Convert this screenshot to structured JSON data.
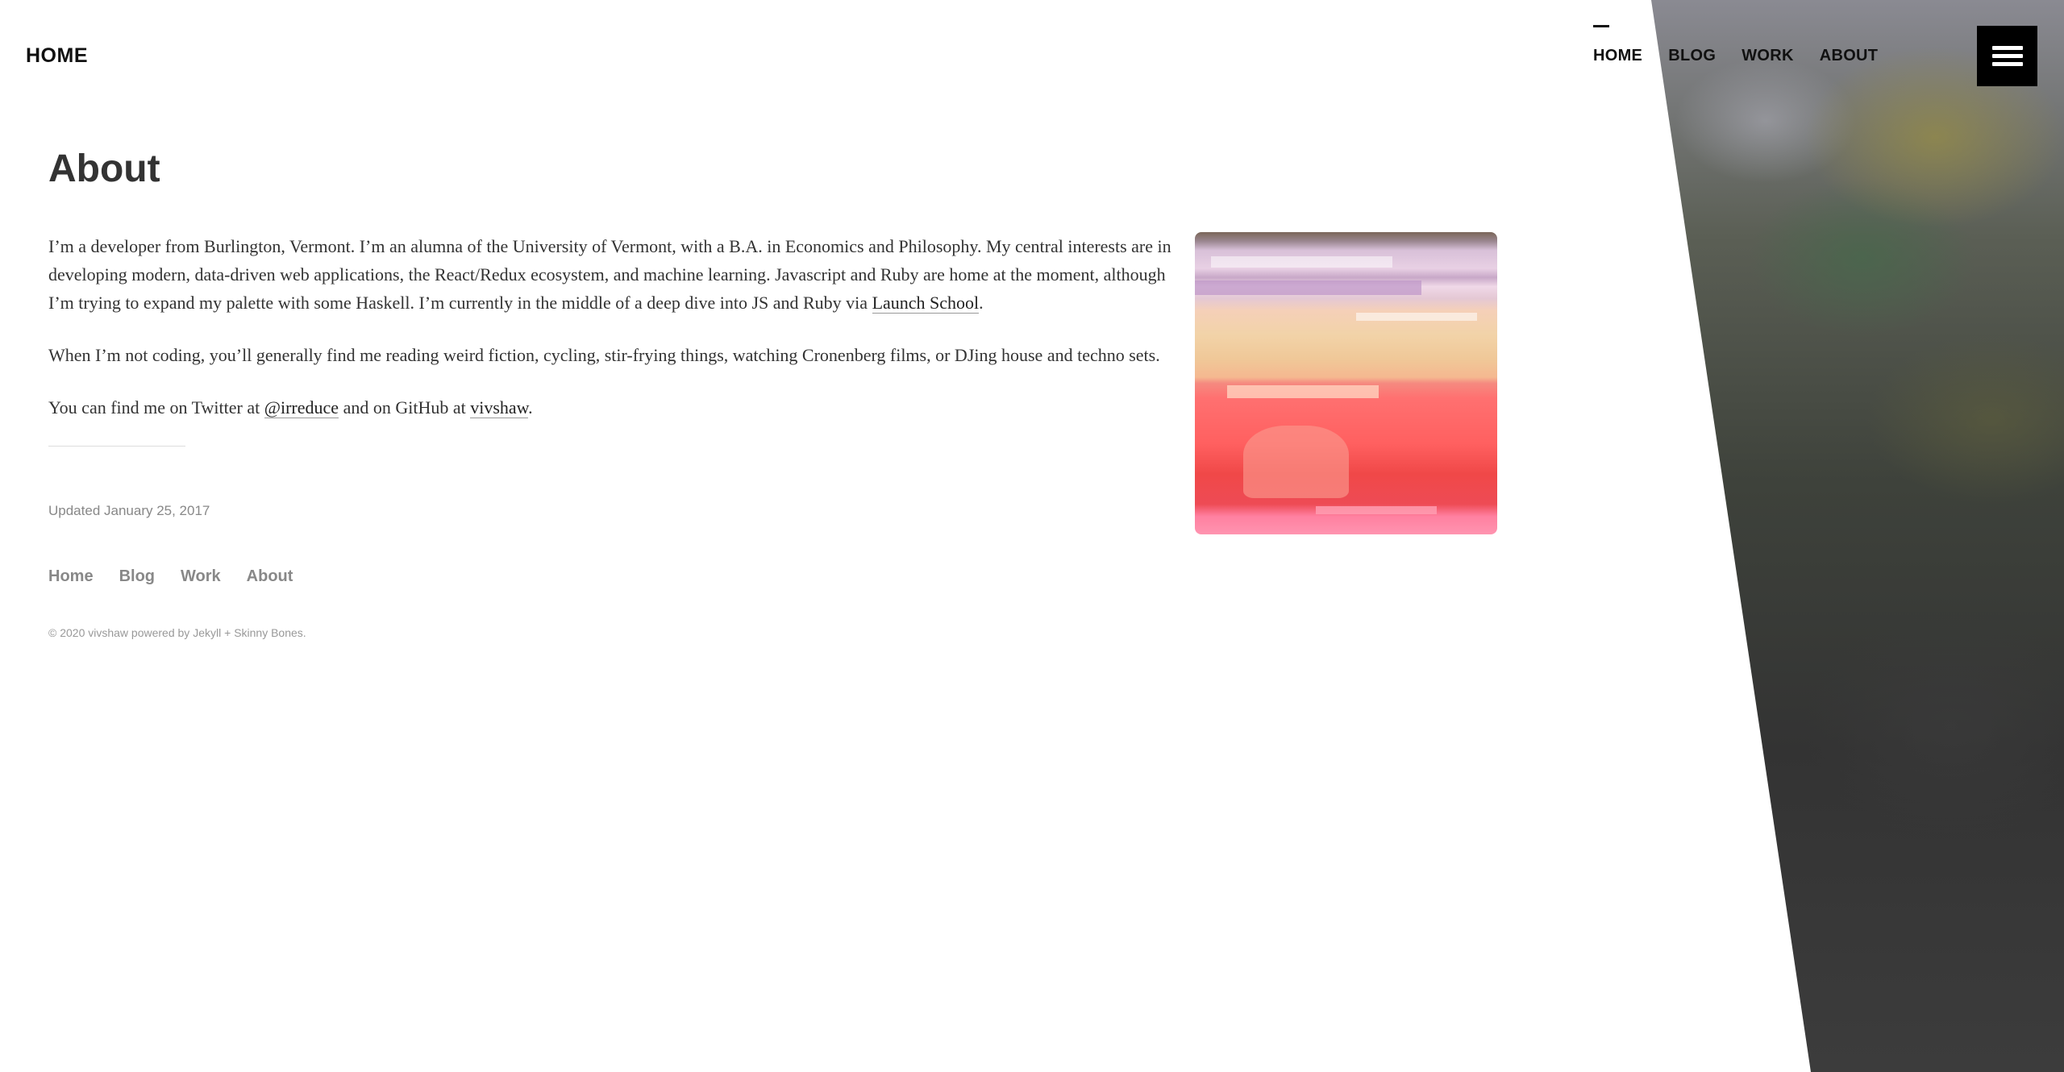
{
  "header": {
    "site_title": "HOME",
    "nav": [
      {
        "label": "HOME",
        "active": true
      },
      {
        "label": "BLOG",
        "active": false
      },
      {
        "label": "WORK",
        "active": false
      },
      {
        "label": "ABOUT",
        "active": false
      }
    ],
    "menu_icon": "hamburger-icon"
  },
  "main": {
    "title": "About",
    "para1_text": "I’m a developer from Burlington, Vermont. I’m an alumna of the University of Vermont, with a B.A. in Economics and Philosophy. My central interests are in developing modern, data-driven web applications, the React/Redux ecosystem, and machine learning. Javascript and Ruby are home at the moment, although I’m trying to expand my palette with some Haskell. I’m currently in the middle of a deep dive into JS and Ruby via ",
    "para1_link": "Launch School",
    "para1_end": ".",
    "para2": "When I’m not coding, you’ll generally find me reading weird fiction, cycling, stir-frying things, watching Cronenberg films, or DJing house and techno sets.",
    "para3_before": "You can find me on Twitter at ",
    "twitter_link": "@irreduce",
    "para3_middle": " and on GitHub at ",
    "github_link": "vivshaw",
    "para3_end": ".",
    "updated": "Updated January 25, 2017"
  },
  "footer": {
    "nav": [
      "Home",
      "Blog",
      "Work",
      "About"
    ],
    "copyright_prefix": "© 2020 vivshaw powered by ",
    "jekyll": "Jekyll",
    "plus": " + ",
    "skinny_bones": "Skinny Bones",
    "period": "."
  },
  "colors": {
    "text": "#333333",
    "muted": "#888888",
    "menu_bg": "#000000"
  }
}
